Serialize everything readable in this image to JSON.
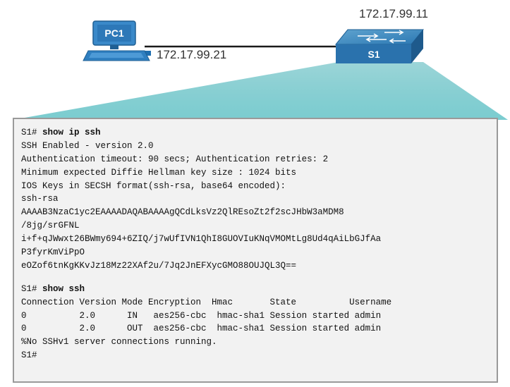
{
  "topology": {
    "pc_label": "PC1",
    "pc_ip": "172.17.99.21",
    "switch_label": "S1",
    "switch_ip": "172.17.99.11"
  },
  "terminal": {
    "lines1": [
      {
        "prompt": "S1# ",
        "command": "show ip ssh"
      },
      {
        "text": "SSH Enabled - version 2.0"
      },
      {
        "text": "Authentication timeout: 90 secs; Authentication retries: 2"
      },
      {
        "text": "Minimum expected Diffie Hellman key size : 1024 bits"
      },
      {
        "text": "IOS Keys in SECSH format(ssh-rsa, base64 encoded):"
      },
      {
        "text": "ssh-rsa"
      },
      {
        "text": "AAAAB3NzaC1yc2EAAAADAQABAAAAgQCdLksVz2QlREsoZt2f2scJHbW3aMDM8"
      },
      {
        "text": "/8jg/srGFNL"
      },
      {
        "text": "i+f+qJWwxt26BWmy694+6ZIQ/j7wUfIVN1QhI8GUOVIuKNqVMOMtLg8Ud4qAiLbGJfAa"
      },
      {
        "text": "P3fyrKmViPpO"
      },
      {
        "text": "eOZof6tnKgKKvJz18Mz22XAf2u/7Jq2JnEFXycGMO88OUJQL3Q=="
      }
    ],
    "lines2": [
      {
        "prompt": "S1# ",
        "command": "show ssh"
      },
      {
        "text": "Connection Version Mode Encryption  Hmac       State          Username"
      },
      {
        "text": "0          2.0      IN   aes256-cbc  hmac-sha1 Session started admin"
      },
      {
        "text": "0          2.0      OUT  aes256-cbc  hmac-sha1 Session started admin"
      },
      {
        "text": "%No SSHv1 server connections running."
      },
      {
        "prompt": "S1#",
        "command": ""
      }
    ]
  }
}
